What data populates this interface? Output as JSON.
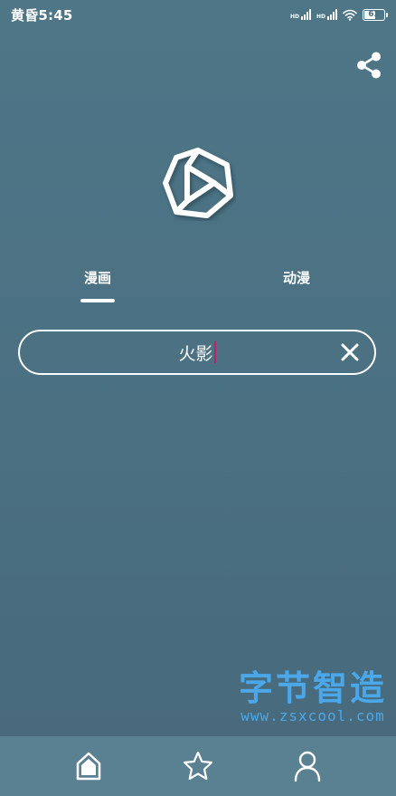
{
  "status_bar": {
    "time": "黄昏5:45",
    "signal1_label": "HD",
    "signal2_label": "HD",
    "battery_level": "63",
    "battery_fraction": 0.63
  },
  "header": {
    "share_icon": "share-icon"
  },
  "logo": {
    "icon": "hexagon-play-logo"
  },
  "tabs": [
    {
      "label": "漫画",
      "active": true
    },
    {
      "label": "动漫",
      "active": false
    }
  ],
  "search": {
    "value": "火影",
    "placeholder": "",
    "clear_icon": "close-icon",
    "caret_color": "#c81a6b"
  },
  "watermark": {
    "title": "字节智造",
    "url": "www.zsxcool.com",
    "color": "#4aa8ea"
  },
  "bottom_nav": {
    "items": [
      {
        "icon": "home-icon",
        "active": true
      },
      {
        "icon": "star-icon",
        "active": false
      },
      {
        "icon": "user-icon",
        "active": false
      }
    ]
  },
  "colors": {
    "background": "#4a7082",
    "bottom_nav": "#5a8192",
    "foreground": "#ffffff"
  }
}
